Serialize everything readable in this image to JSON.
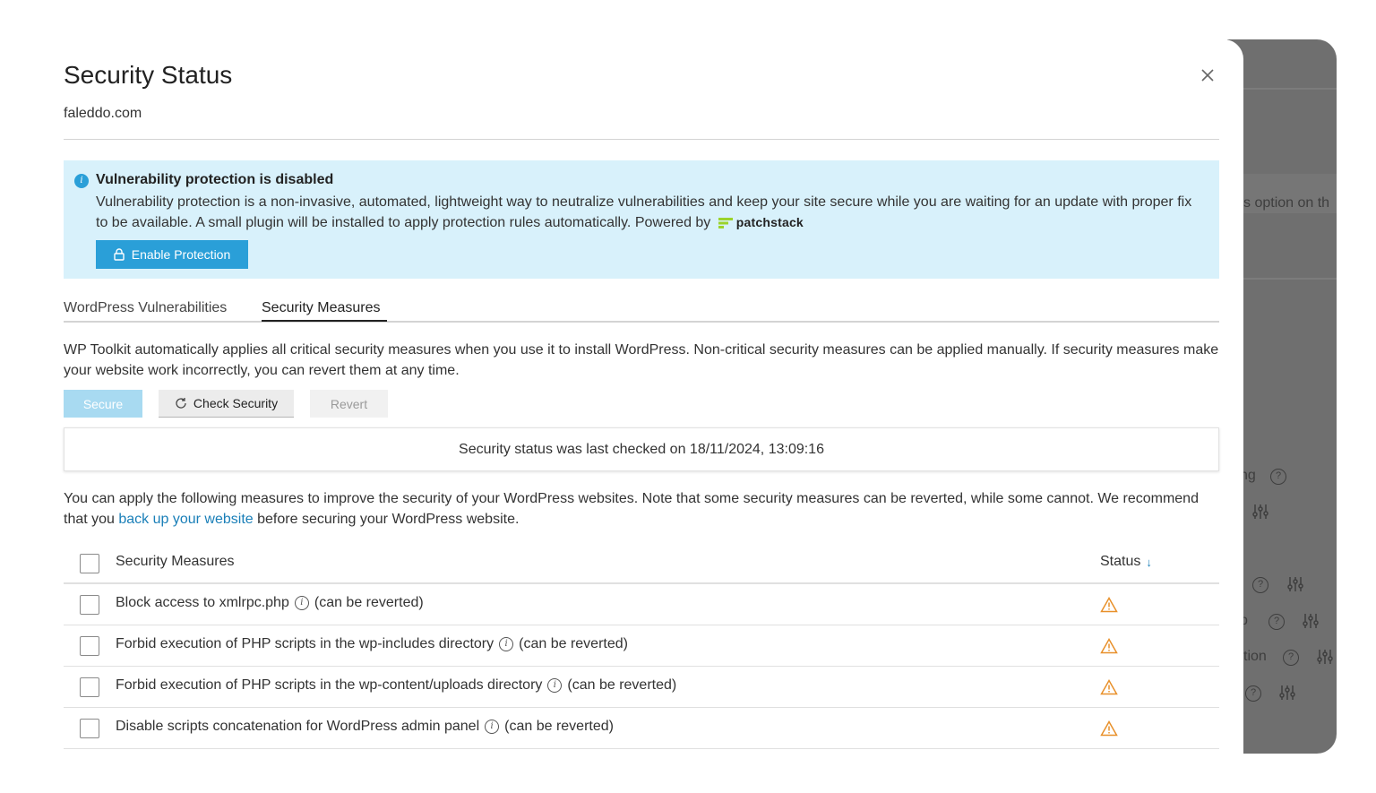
{
  "modal": {
    "title": "Security Status",
    "subtitle": "faleddo.com"
  },
  "alert": {
    "title": "Vulnerability protection is disabled",
    "body": "Vulnerability protection is a non-invasive, automated, lightweight way to neutralize vulnerabilities and keep your site secure while you are waiting for an update with proper fix to be available. A small plugin will be installed to apply protection rules automatically. Powered by",
    "powered_by": "patchstack",
    "button_label": "Enable Protection"
  },
  "tabs": [
    {
      "label": "WordPress Vulnerabilities"
    },
    {
      "label": "Security Measures"
    }
  ],
  "description": "WP Toolkit automatically applies all critical security measures when you use it to install WordPress. Non-critical security measures can be applied manually. If security measures make your website work incorrectly, you can revert them at any time.",
  "buttons": {
    "secure": "Secure",
    "check": "Check Security",
    "revert": "Revert"
  },
  "status_message": "Security status was last checked on 18/11/2024, 13:09:16",
  "note": {
    "before": "You can apply the following measures to improve the security of your WordPress websites. Note that some security measures can be reverted, while some cannot. We recommend that you ",
    "link": "back up your website",
    "after": " before securing your WordPress website."
  },
  "table": {
    "col_measures": "Security Measures",
    "col_status": "Status",
    "sort_arrow": "↓",
    "rows": [
      {
        "name": "Block access to xmlrpc.php",
        "note": "(can be reverted)"
      },
      {
        "name": "Forbid execution of PHP scripts in the wp-includes directory",
        "note": "(can be reverted)"
      },
      {
        "name": "Forbid execution of PHP scripts in the wp-content/uploads directory",
        "note": "(can be reverted)"
      },
      {
        "name": "Disable scripts concatenation for WordPress admin panel",
        "note": "(can be reverted)"
      }
    ]
  },
  "background": {
    "text1": "s option on th",
    "text2": "ng",
    "text3": "p",
    "text4": "tion"
  },
  "colors": {
    "primary": "#2a9fd8",
    "alert_bg": "#d8f1fb",
    "warning": "#e8902a",
    "link": "#1a7fb8"
  },
  "icons": {
    "close": "close-icon",
    "info": "info-icon",
    "lock": "lock-icon",
    "refresh": "refresh-icon",
    "warning": "warning-icon"
  }
}
